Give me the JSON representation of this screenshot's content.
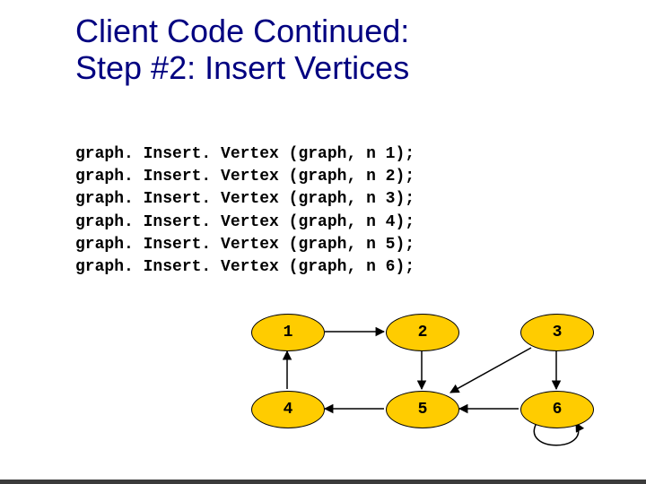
{
  "title_line1": "Client Code Continued:",
  "title_line2": "Step #2: Insert Vertices",
  "code": {
    "rows": [
      {
        "fn": "graph. Insert. Vertex ",
        "mid": "(graph, ",
        "arg": "n 1); "
      },
      {
        "fn": "graph. Insert. Vertex ",
        "mid": "(graph, ",
        "arg": "n 2); "
      },
      {
        "fn": "graph. Insert. Vertex ",
        "mid": "(graph, ",
        "arg": "n 3); "
      },
      {
        "fn": "graph. Insert. Vertex ",
        "mid": "(graph, ",
        "arg": "n 4); "
      },
      {
        "fn": "graph. Insert. Vertex ",
        "mid": "(graph, ",
        "arg": "n 5); "
      },
      {
        "fn": "graph. Insert. Vertex ",
        "mid": "(graph, ",
        "arg": "n 6); "
      }
    ]
  },
  "nodes": {
    "n1": "1",
    "n2": "2",
    "n3": "3",
    "n4": "4",
    "n5": "5",
    "n6": "6"
  }
}
